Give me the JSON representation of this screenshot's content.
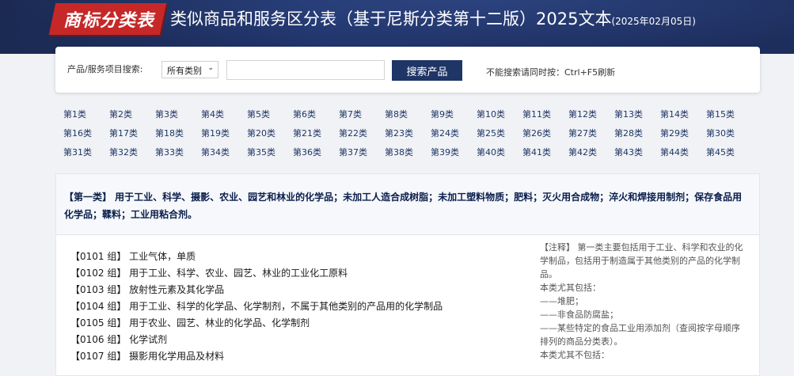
{
  "header": {
    "badge": "商标分类表",
    "title": "类似商品和服务区分表（基于尼斯分类第十二版）2025文本",
    "date": "(2025年02月05日)"
  },
  "search": {
    "label": "产品/服务项目搜索:",
    "select_value": "所有类别",
    "input_value": "",
    "button_label": "搜索产品",
    "hint": "不能搜索请同时按：Ctrl+F5刷新"
  },
  "classes": [
    "第1类",
    "第2类",
    "第3类",
    "第4类",
    "第5类",
    "第6类",
    "第7类",
    "第8类",
    "第9类",
    "第10类",
    "第11类",
    "第12类",
    "第13类",
    "第14类",
    "第15类",
    "第16类",
    "第17类",
    "第18类",
    "第19类",
    "第20类",
    "第21类",
    "第22类",
    "第23类",
    "第24类",
    "第25类",
    "第26类",
    "第27类",
    "第28类",
    "第29类",
    "第30类",
    "第31类",
    "第32类",
    "第33类",
    "第34类",
    "第35类",
    "第36类",
    "第37类",
    "第38类",
    "第39类",
    "第40类",
    "第41类",
    "第42类",
    "第43类",
    "第44类",
    "第45类"
  ],
  "class_section": {
    "heading": "【第一类】 用于工业、科学、摄影、农业、园艺和林业的化学品；未加工人造合成树脂；未加工塑料物质；肥料；灭火用合成物；淬火和焊接用制剂；保存食品用化学品；鞣料；工业用粘合剂。",
    "groups": [
      "【0101 组】 工业气体，单质",
      "【0102 组】 用于工业、科学、农业、园艺、林业的工业化工原料",
      "【0103 组】 放射性元素及其化学品",
      "【0104 组】 用于工业、科学的化学品、化学制剂，不属于其他类别的产品用的化学制品",
      "【0105 组】 用于农业、园艺、林业的化学品、化学制剂",
      "【0106 组】 化学试剂",
      "【0107 组】 摄影用化学用品及材料"
    ],
    "notes": [
      "【注释】 第一类主要包括用于工业、科学和农业的化学制品，包括用于制造属于其他类别的产品的化学制品。",
      "本类尤其包括：",
      "——堆肥；",
      "——非食品防腐盐；",
      "——某些特定的食品工业用添加剂（查阅按字母顺序排列的商品分类表）。",
      "本类尤其不包括："
    ]
  },
  "colors": {
    "navy": "#1f3566",
    "badge_red": "#c62828",
    "header_bg": "#1b2a52"
  }
}
